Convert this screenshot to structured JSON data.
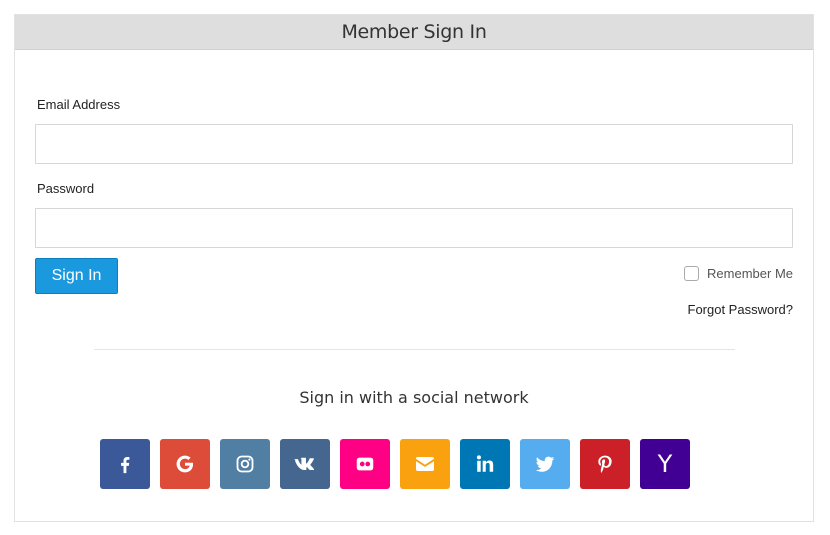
{
  "card": {
    "title": "Member Sign In"
  },
  "form": {
    "email_label": "Email Address",
    "email_value": "",
    "password_label": "Password",
    "password_value": "",
    "signin_label": "Sign In",
    "remember_label": "Remember Me",
    "remember_checked": false,
    "forgot_label": "Forgot Password?"
  },
  "social": {
    "heading": "Sign in with a social network",
    "buttons": [
      {
        "icon": "facebook-icon",
        "color": "#3b5998"
      },
      {
        "icon": "google-icon",
        "color": "#dd4b39"
      },
      {
        "icon": "instagram-icon",
        "color": "#517fa4"
      },
      {
        "icon": "vk-icon",
        "color": "#45668e"
      },
      {
        "icon": "flickr-icon",
        "color": "#ff0084"
      },
      {
        "icon": "email-icon",
        "color": "#f9a10f"
      },
      {
        "icon": "linkedin-icon",
        "color": "#0077b5"
      },
      {
        "icon": "twitter-icon",
        "color": "#55acee"
      },
      {
        "icon": "pinterest-icon",
        "color": "#cb2027"
      },
      {
        "icon": "yahoo-icon",
        "color": "#410093"
      }
    ]
  }
}
